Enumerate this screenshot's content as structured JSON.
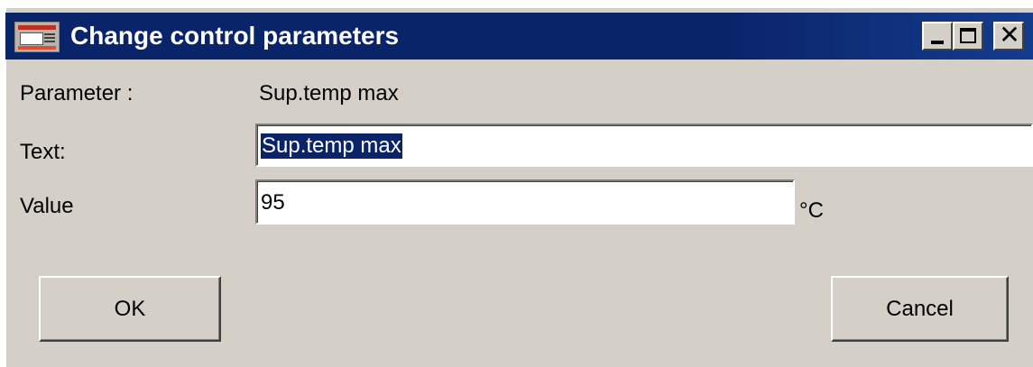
{
  "window": {
    "title": "Change control parameters",
    "app_icon": "app-monitor-icon",
    "controls": {
      "minimize_icon": "minimize-icon",
      "maximize_icon": "maximize-icon",
      "close_icon": "close-icon",
      "close_glyph": "✕"
    },
    "colors": {
      "titlebar": "#0a246a",
      "face": "#d4d0c8",
      "selection": "#0a246a"
    }
  },
  "form": {
    "parameter_label": "Parameter :",
    "parameter_value": "Sup.temp max",
    "text_label": "Text:",
    "text_value": "Sup.temp max",
    "value_label": "Value",
    "value_value": "95",
    "value_unit": "°C"
  },
  "buttons": {
    "ok_label": "OK",
    "cancel_label": "Cancel"
  }
}
